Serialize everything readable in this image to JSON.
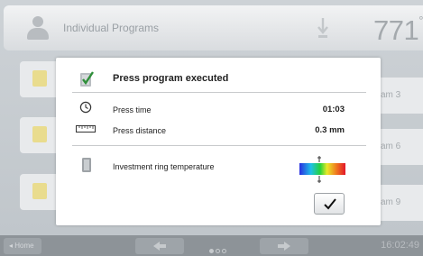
{
  "header": {
    "title": "Individual Programs",
    "temperature": "771",
    "temperature_unit": "°C"
  },
  "background_tiles": {
    "right_labels": [
      "am 3",
      "am 6",
      "am 9"
    ]
  },
  "footer": {
    "home_label": "Home",
    "clock": "16:02:49",
    "page_dots": 3,
    "active_page": 1
  },
  "dialog": {
    "title": "Press program executed",
    "rows": [
      {
        "label": "Press time",
        "value": "01:03"
      },
      {
        "label": "Press distance",
        "value": "0.3 mm"
      }
    ],
    "ring_label": "Investment ring temperature",
    "ok_icon": "checkmark-icon"
  },
  "colors": {
    "dialog_bg": "#ffffff",
    "screen_bg": "#c7ccd0",
    "footer_bg": "#8d9398",
    "tile_accent": "#e9dc8e"
  }
}
